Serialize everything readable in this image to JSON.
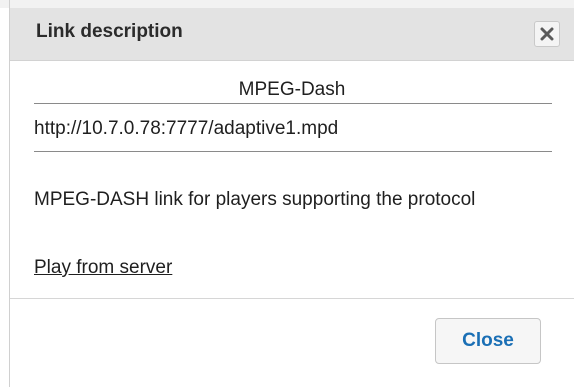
{
  "dialog": {
    "title": "Link description",
    "close_icon": "close-icon",
    "subtitle": "MPEG-Dash",
    "url": "http://10.7.0.78:7777/adaptive1.mpd",
    "description": "MPEG-DASH link for players supporting the protocol",
    "play_link": "Play from server",
    "close_button": "Close"
  },
  "colors": {
    "titlebar": "#e3e3e3",
    "link_button_text": "#1a6fb5"
  }
}
